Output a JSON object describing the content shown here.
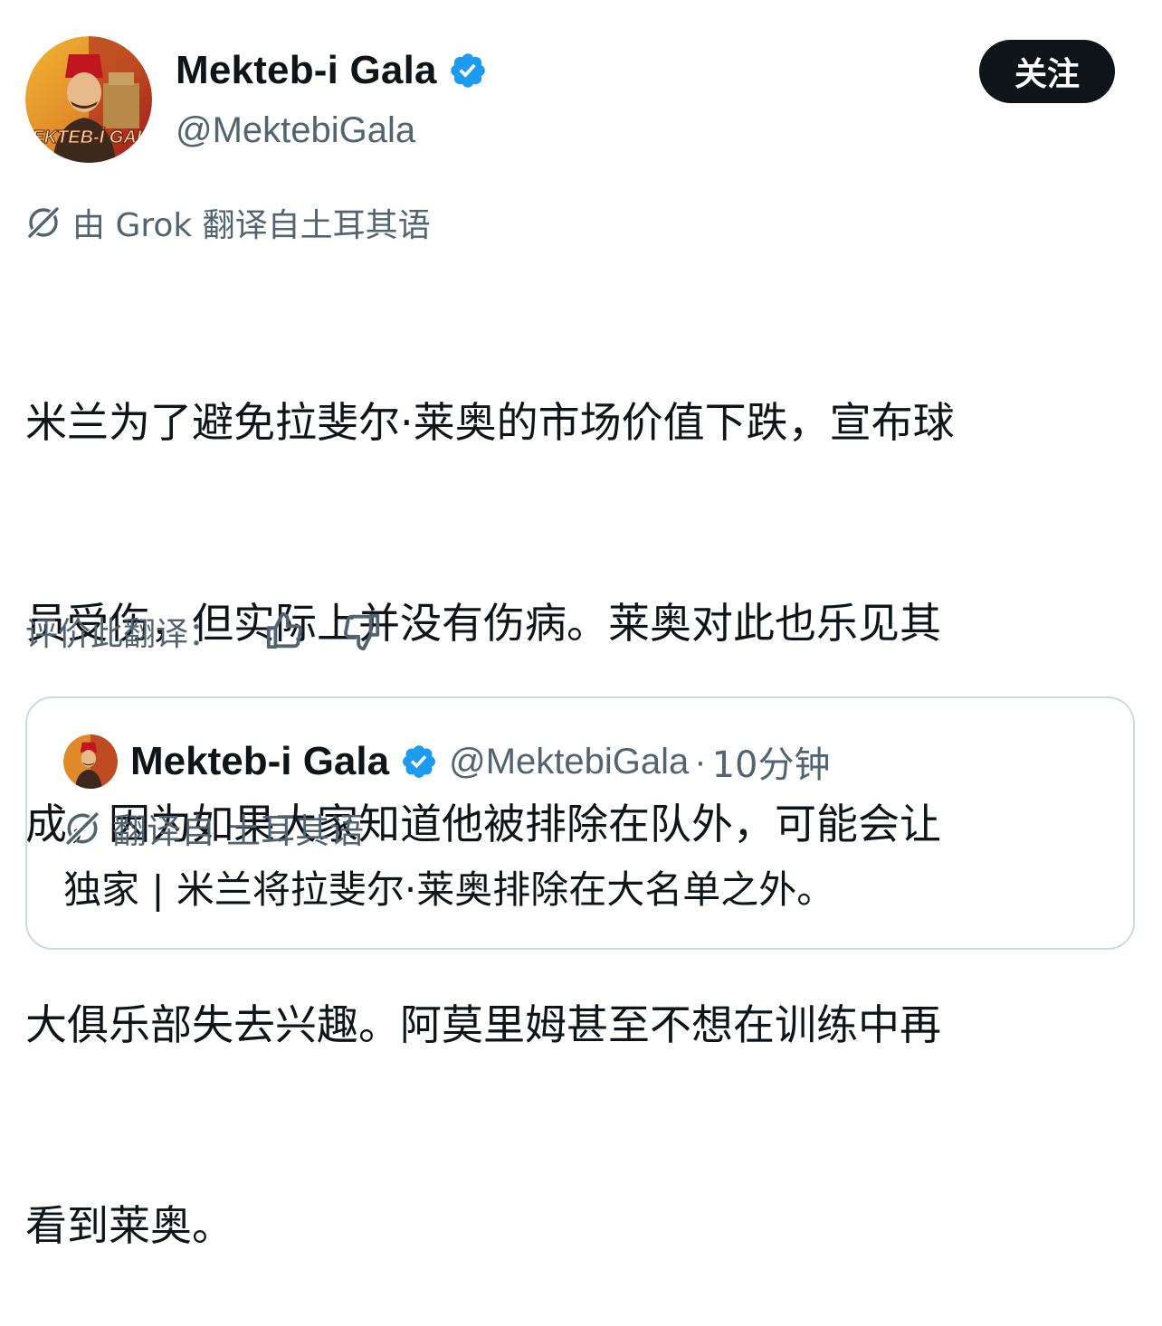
{
  "author": {
    "display_name": "Mekteb-i Gala",
    "handle": "@MektebiGala",
    "verified": true,
    "avatar_text": "MEKTEB-İ GALA"
  },
  "follow_button": {
    "label": "关注"
  },
  "translation_note": {
    "text": "由 Grok 翻译自土耳其语"
  },
  "tweet": {
    "lines": [
      "米兰为了避免拉斐尔·莱奥的市场价值下跌，宣布球",
      "员受伤，但实际上并没有伤病。莱奥对此也乐见其",
      "成，因为如果大家知道他被排除在队外，可能会让",
      "大俱乐部失去兴趣。阿莫里姆甚至不想在训练中再",
      "看到莱奥。"
    ]
  },
  "rate_translation": {
    "label": "评价此翻译："
  },
  "quoted_tweet": {
    "display_name": "Mekteb-i Gala",
    "handle": "@MektebiGala",
    "separator": "·",
    "time": "10分钟",
    "translation_note": "翻译自 土耳其语",
    "text": "独家 | 米兰将拉斐尔·莱奥排除在大名单之外。"
  },
  "colors": {
    "primary_text": "#0f1419",
    "secondary_text": "#536471",
    "verified_blue": "#1d9bf0",
    "button_bg": "#0f1419",
    "border": "#cfd9de"
  }
}
